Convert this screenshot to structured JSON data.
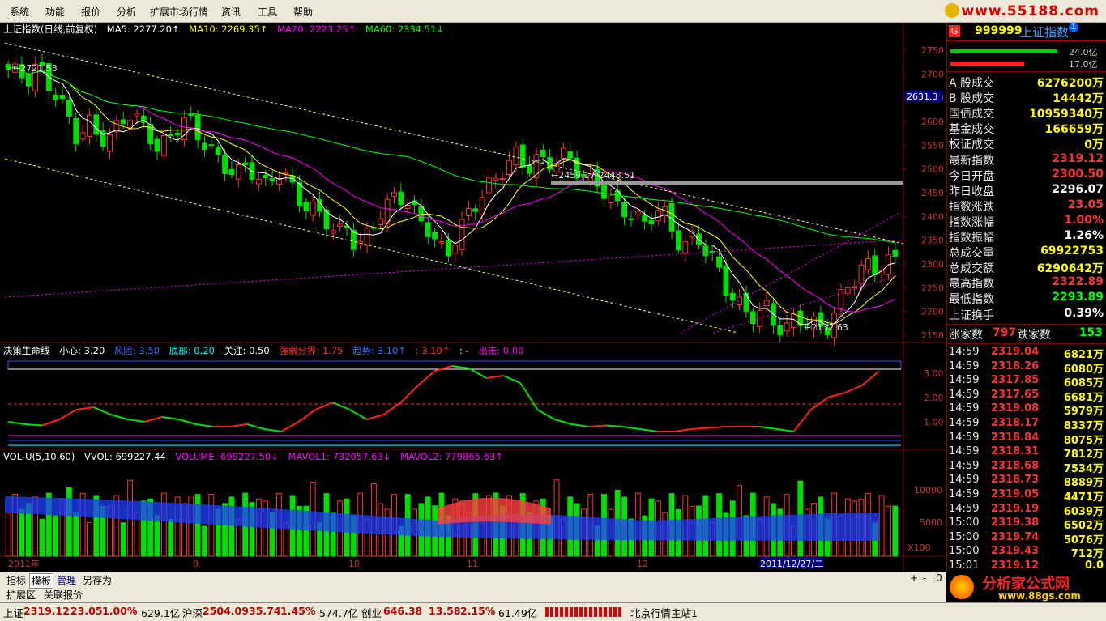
{
  "menu": [
    "系统",
    "功能",
    "报价",
    "分析",
    "扩展市场行情",
    "资讯",
    "工具",
    "帮助"
  ],
  "site_logo": "www.55188.com",
  "main_info": {
    "title": "上证指数(日线,前复权)",
    "ma5": "MA5: 2277.20↑",
    "ma10": "MA10: 2269.35↑",
    "ma20": "MA20: 2223.25↑",
    "ma60": "MA60: 2334.51↓"
  },
  "price_axis": [
    "2750",
    "2700",
    "2650",
    "2600",
    "2550",
    "2500",
    "2450",
    "2400",
    "2350",
    "2300",
    "2250",
    "2200",
    "2150"
  ],
  "price_values": [
    2750,
    2700,
    2650,
    2600,
    2550,
    2500,
    2450,
    2400,
    2350,
    2300,
    2250,
    2200,
    2150
  ],
  "current_price_tag": "2631.3",
  "annotations": {
    "high": "2721.53",
    "mid": "2459.17-2448.51",
    "low": "2132.63"
  },
  "indicator1": {
    "name": "决策生命线",
    "xiaoxin": "小心: 3.20",
    "fengxian": "风险: 3.50",
    "dibu": "底部: 0.20",
    "guanzhu": "关注: 0.50",
    "qiangruo": "强弱分界: 1.75",
    "qushi": "趋势: 3.10↑",
    "v3": ": 3.10↑",
    "dash": ": -",
    "chuji": "出击: 0.00",
    "axis": [
      "3.00",
      "2.00",
      "1.00"
    ],
    "axis_values": [
      3,
      2,
      1
    ]
  },
  "volume": {
    "name": "VOL-U(5,10,60)",
    "vvol": "VVOL: 699227.44",
    "volume": "VOLUME: 699227.50↓",
    "mavol1": "MAVOL1: 732057.63↓",
    "mavol2": "MAVOL2: 779865.63↑",
    "axis": [
      "10000",
      "5000",
      "X100"
    ]
  },
  "time_axis": [
    "2011年",
    "9",
    "10",
    "11",
    "12",
    "2011/12/27/二"
  ],
  "right_header": {
    "badge": "G",
    "code": "999999",
    "name": "上证指数",
    "bar1": "24.0亿",
    "bar2": "17.0亿"
  },
  "stats": [
    {
      "label": "A 股成交",
      "value": "6276200万",
      "color": "#ffff00"
    },
    {
      "label": "B 股成交",
      "value": "14442万",
      "color": "#ffff00"
    },
    {
      "label": "国债成交",
      "value": "10959340万",
      "color": "#ffff00"
    },
    {
      "label": "基金成交",
      "value": "166659万",
      "color": "#ffff00"
    },
    {
      "label": "权证成交",
      "value": "0万",
      "color": "#ffff00"
    },
    {
      "label": "最新指数",
      "value": "2319.12",
      "color": "#ff3232"
    },
    {
      "label": "今日开盘",
      "value": "2300.50",
      "color": "#ff3232"
    },
    {
      "label": "昨日收盘",
      "value": "2296.07",
      "color": "#ffffff"
    },
    {
      "label": "指数涨跌",
      "value": "23.05",
      "color": "#ff3232"
    },
    {
      "label": "指数涨幅",
      "value": "1.00%",
      "color": "#ff3232"
    },
    {
      "label": "指数振幅",
      "value": "1.26%",
      "color": "#ffffff"
    },
    {
      "label": "总成交量",
      "value": "69922753",
      "color": "#ffff00"
    },
    {
      "label": "总成交额",
      "value": "6290642万",
      "color": "#ffff00"
    },
    {
      "label": "最高指数",
      "value": "2322.89",
      "color": "#ff3232"
    },
    {
      "label": "最低指数",
      "value": "2293.89",
      "color": "#00ff00"
    },
    {
      "label": "上证换手",
      "value": "0.39%",
      "color": "#ffffff"
    }
  ],
  "updown": {
    "up_label": "涨家数",
    "up": "797",
    "down_label": "跌家数",
    "down": "153"
  },
  "ticks": [
    {
      "time": "14:59",
      "price": "2319.04",
      "vol": "6821万",
      "pc": "#ff3232",
      "vc": "#ffff00"
    },
    {
      "time": "14:59",
      "price": "2318.26",
      "vol": "6080万",
      "pc": "#ff3232",
      "vc": "#ffff00"
    },
    {
      "time": "14:59",
      "price": "2317.85",
      "vol": "6085万",
      "pc": "#ff3232",
      "vc": "#ffff00"
    },
    {
      "time": "14:59",
      "price": "2317.65",
      "vol": "6681万",
      "pc": "#ff3232",
      "vc": "#ffff00"
    },
    {
      "time": "14:59",
      "price": "2319.08",
      "vol": "5979万",
      "pc": "#ff3232",
      "vc": "#ffff00"
    },
    {
      "time": "14:59",
      "price": "2318.17",
      "vol": "8337万",
      "pc": "#ff3232",
      "vc": "#ffff00"
    },
    {
      "time": "14:59",
      "price": "2318.84",
      "vol": "8075万",
      "pc": "#ff3232",
      "vc": "#ffff00"
    },
    {
      "time": "14:59",
      "price": "2318.31",
      "vol": "7812万",
      "pc": "#ff3232",
      "vc": "#ffff00"
    },
    {
      "time": "14:59",
      "price": "2318.68",
      "vol": "7534万",
      "pc": "#ff3232",
      "vc": "#ffff00"
    },
    {
      "time": "14:59",
      "price": "2318.73",
      "vol": "8889万",
      "pc": "#ff3232",
      "vc": "#ffff00"
    },
    {
      "time": "14:59",
      "price": "2319.05",
      "vol": "4471万",
      "pc": "#ff3232",
      "vc": "#ffff00"
    },
    {
      "time": "14:59",
      "price": "2319.19",
      "vol": "6039万",
      "pc": "#ff3232",
      "vc": "#ffff00"
    },
    {
      "time": "15:00",
      "price": "2319.38",
      "vol": "6502万",
      "pc": "#ff3232",
      "vc": "#ffff00"
    },
    {
      "time": "15:00",
      "price": "2319.74",
      "vol": "5076万",
      "pc": "#ff3232",
      "vc": "#ffff00"
    },
    {
      "time": "15:00",
      "price": "2319.43",
      "vol": "712万",
      "pc": "#ff3232",
      "vc": "#ffff00"
    },
    {
      "time": "15:01",
      "price": "2319.12",
      "vol": "0.0",
      "pc": "#ff3232",
      "vc": "#ffff00"
    }
  ],
  "tabs_row1": [
    "指标",
    "模板",
    "管理",
    "另存为"
  ],
  "tabs_row2": [
    "扩展区",
    "关联报价"
  ],
  "day_label": "日线",
  "zoom_controls": [
    "+",
    "-",
    "0"
  ],
  "status": {
    "sh_name": "上证",
    "sh_price": "2319.12",
    "sh_chg": "23.05",
    "sh_pct": "1.00%",
    "sh_amt": "629.1亿",
    "sz_name": "沪深",
    "sz_price": "2504.09",
    "sz_chg": "35.74",
    "sz_pct": "1.45%",
    "sz_amt": "574.7亿",
    "cy_name": "创业",
    "cy_price": "646.38",
    "cy_chg": "13.58",
    "cy_pct": "2.15%",
    "cy_amt": "61.49亿",
    "server": "北京行情主站1"
  },
  "bottom_logo": {
    "title": "分析家公式网",
    "url": "www.88gs.com"
  },
  "colors": {
    "up": "#ff3232",
    "down": "#00e000",
    "ma5": "#ffffff",
    "ma10": "#ffff00",
    "ma20": "#ff00ff",
    "ma60": "#00ff00",
    "accent": "#000080"
  }
}
